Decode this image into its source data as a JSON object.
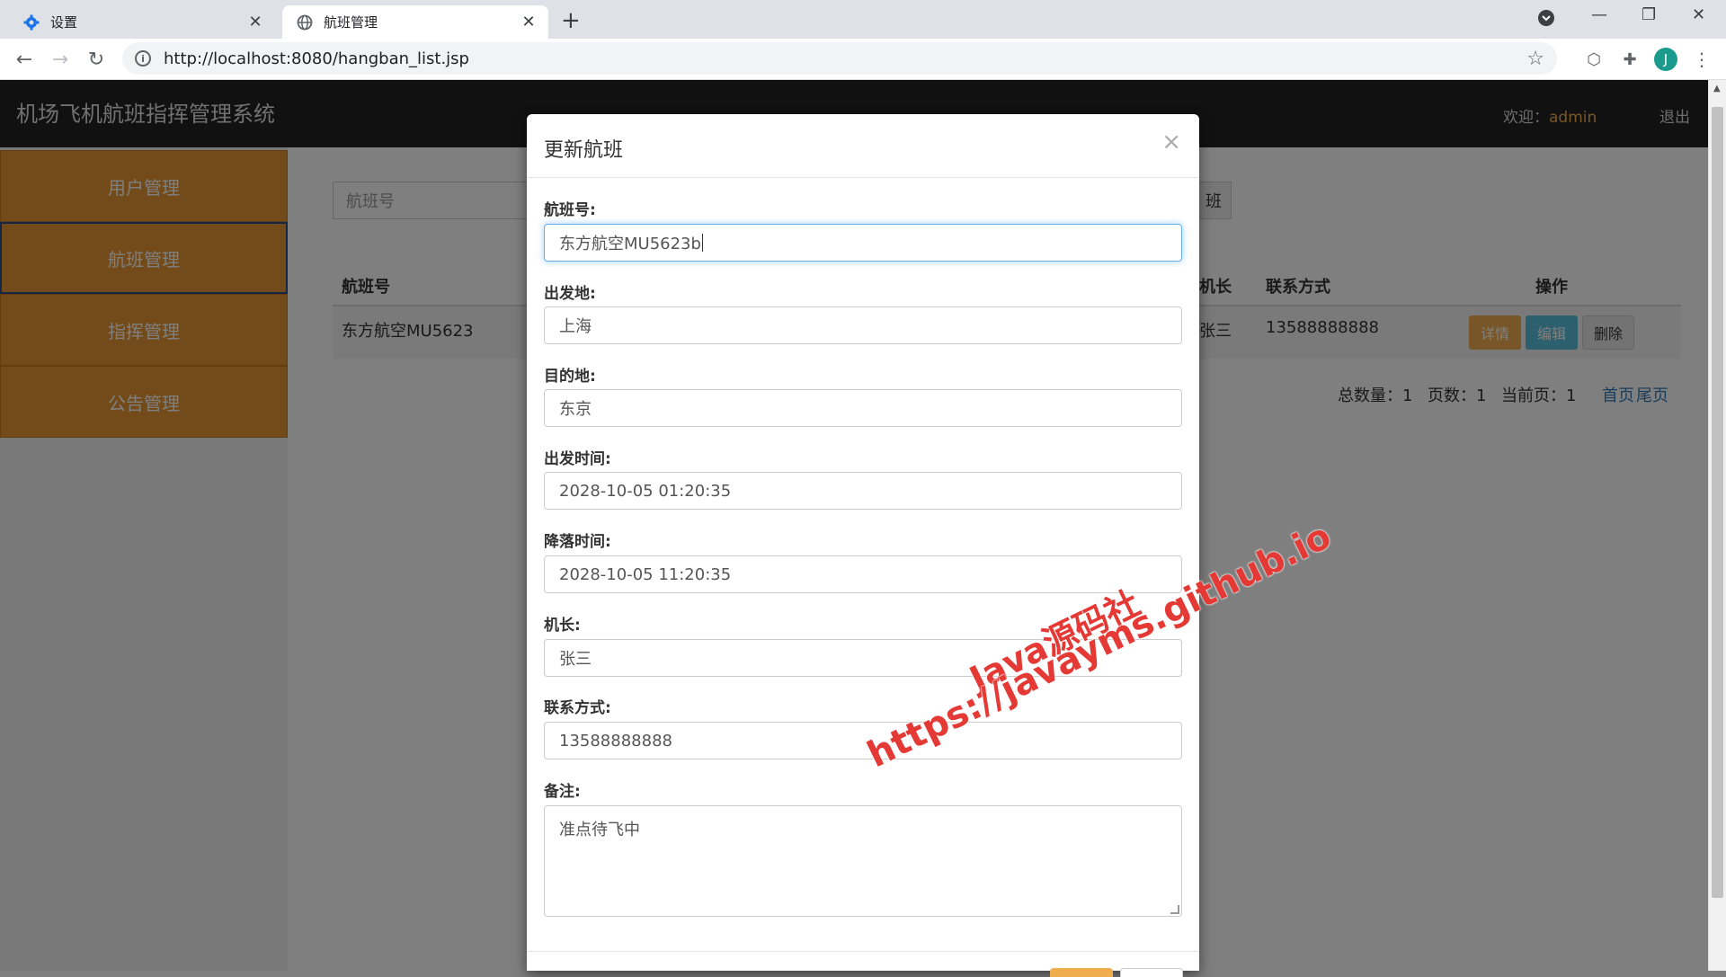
{
  "browser": {
    "tabs": [
      {
        "title": "设置",
        "icon": "gear-icon"
      },
      {
        "title": "航班管理",
        "icon": "globe-icon"
      }
    ],
    "url": "http://localhost:8080/hangban_list.jsp",
    "avatar_letter": "J"
  },
  "header": {
    "title": "机场飞机航班指挥管理系统",
    "welcome_label": "欢迎：",
    "username": "admin",
    "logout": "退出"
  },
  "sidebar": {
    "items": [
      {
        "label": "用户管理"
      },
      {
        "label": "航班管理"
      },
      {
        "label": "指挥管理"
      },
      {
        "label": "公告管理"
      }
    ]
  },
  "list": {
    "search_placeholder": "航班号",
    "add_button_fragment": "班",
    "columns": [
      "航班号",
      "机长",
      "联系方式",
      "操作"
    ],
    "rows": [
      {
        "flight_no": "东方航空MU5623",
        "captain_fragment": "张三",
        "phone": "13588888888"
      }
    ],
    "actions": {
      "detail": "详情",
      "edit": "编辑",
      "delete": "删除"
    },
    "pager": {
      "total": "总数量：1",
      "pages": "页数：1",
      "current": "当前页：1",
      "first": "首页",
      "last": "尾页"
    }
  },
  "modal": {
    "title": "更新航班",
    "close": "×",
    "fields": [
      {
        "label": "航班号:",
        "value": "东方航空MU5623b"
      },
      {
        "label": "出发地:",
        "value": "上海"
      },
      {
        "label": "目的地:",
        "value": "东京"
      },
      {
        "label": "出发时间:",
        "value": "2028-10-05 01:20:35"
      },
      {
        "label": "降落时间:",
        "value": "2028-10-05 11:20:35"
      },
      {
        "label": "机长:",
        "value": "张三"
      },
      {
        "label": "联系方式:",
        "value": "13588888888"
      }
    ],
    "remark": {
      "label": "备注:",
      "value": "准点待飞中"
    }
  },
  "watermark": {
    "line1": "Java源码社",
    "line2": "https://javayms.github.io"
  },
  "colors": {
    "sidebar_item": "#e69533",
    "detail_btn": "#f0ad4e",
    "edit_btn": "#5bc0de",
    "delete_btn": "#e6e6e6",
    "watermark": "#e53935"
  }
}
